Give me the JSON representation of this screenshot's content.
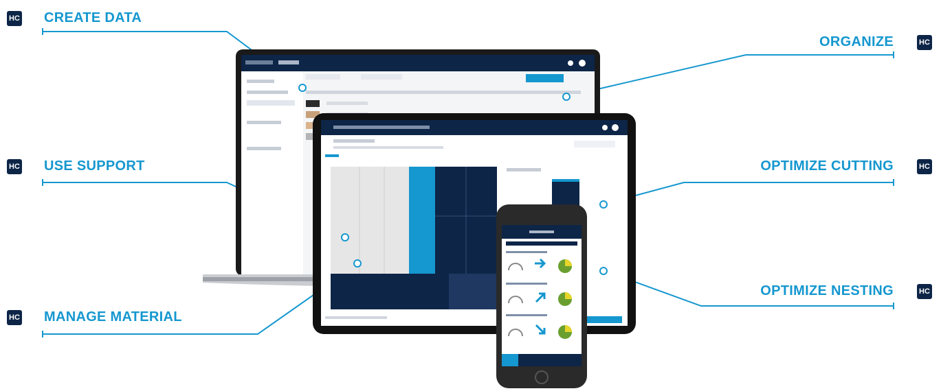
{
  "features": {
    "create_data": "CREATE DATA",
    "use_support": "USE SUPPORT",
    "manage_material": "MANAGE MATERIAL",
    "organize": "ORGANIZE",
    "optimize_cutting": "OPTIMIZE CUTTING",
    "optimize_nesting": "OPTIMIZE NESTING"
  },
  "logo": {
    "text": "HC",
    "color": "#0d2547"
  },
  "colors": {
    "accent": "#1597cf",
    "navy": "#0d2547"
  }
}
